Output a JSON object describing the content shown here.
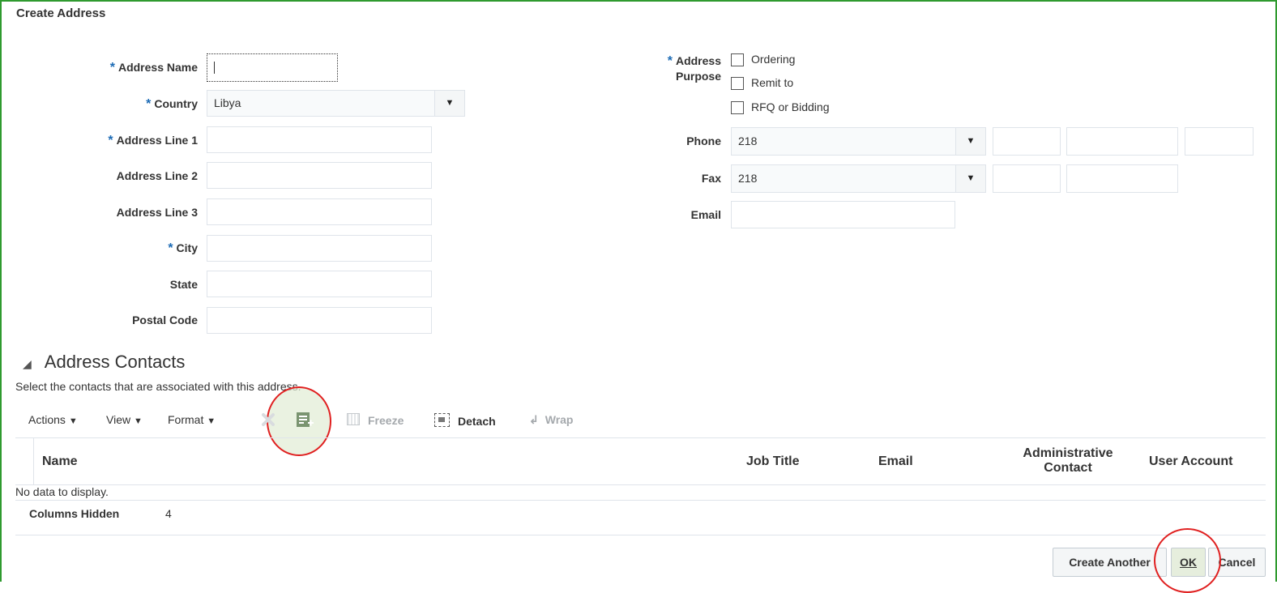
{
  "dialog": {
    "title": "Create Address"
  },
  "form": {
    "address_name": {
      "label": "Address Name",
      "value": "",
      "required": true
    },
    "country": {
      "label": "Country",
      "value": "Libya",
      "required": true
    },
    "address_line1": {
      "label": "Address Line 1",
      "value": "",
      "required": true
    },
    "address_line2": {
      "label": "Address Line 2",
      "value": ""
    },
    "address_line3": {
      "label": "Address Line 3",
      "value": ""
    },
    "city": {
      "label": "City",
      "value": "",
      "required": true
    },
    "state": {
      "label": "State",
      "value": ""
    },
    "postal_code": {
      "label": "Postal Code",
      "value": ""
    },
    "address_purpose": {
      "label_line1": "Address",
      "label_line2": "Purpose",
      "required": true,
      "options": [
        {
          "label": "Ordering",
          "checked": false
        },
        {
          "label": "Remit to",
          "checked": false
        },
        {
          "label": "RFQ or Bidding",
          "checked": false
        }
      ]
    },
    "phone": {
      "label": "Phone",
      "country_code": "218"
    },
    "fax": {
      "label": "Fax",
      "country_code": "218"
    },
    "email": {
      "label": "Email",
      "value": ""
    },
    "required_marker": "*"
  },
  "contacts": {
    "title": "Address Contacts",
    "hint": "Select the contacts that are associated with this address.",
    "toolbar": {
      "actions": "Actions",
      "view": "View",
      "format": "Format",
      "freeze": "Freeze",
      "detach": "Detach",
      "wrap": "Wrap"
    },
    "columns": [
      "Name",
      "Job Title",
      "Email",
      "Administrative Contact",
      "User Account"
    ],
    "admin_col_line1": "Administrative",
    "admin_col_line2": "Contact",
    "empty_text": "No data to display.",
    "columns_hidden_label": "Columns Hidden",
    "columns_hidden_count": "4"
  },
  "buttons": {
    "create_another": "Create Another",
    "ok": "OK",
    "cancel": "Cancel"
  },
  "colors": {
    "frame_border": "#2f9a2f",
    "required_star": "#1c6bb5",
    "highlight_circle": "#e02020"
  }
}
